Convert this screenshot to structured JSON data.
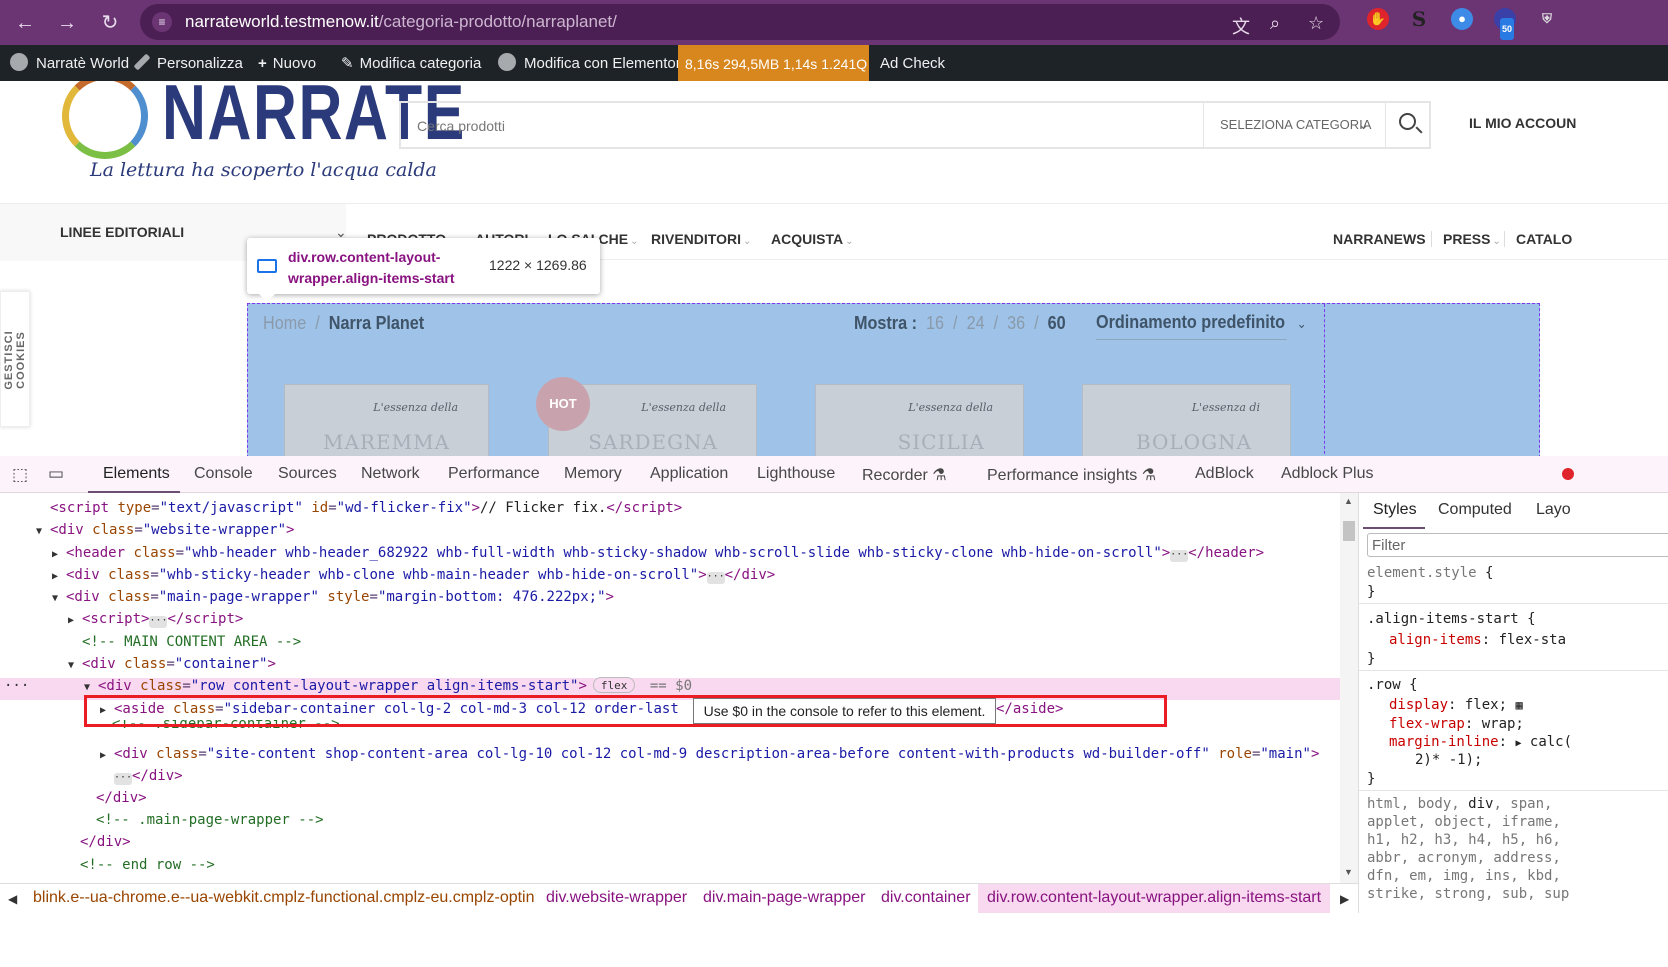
{
  "browser": {
    "url_host": "narrateworld.testmenow.it",
    "url_path": "/categoria-prodotto/narraplanet/",
    "nav": {
      "back": "←",
      "forward": "→",
      "reload": "↻"
    },
    "icons": [
      "translate-icon",
      "zoom-icon",
      "bookmark-star-icon"
    ],
    "extension_badge": "50"
  },
  "adminbar": {
    "site": "Narratè World",
    "customize": "Personalizza",
    "new": "Nuovo",
    "edit_category": "Modifica categoria",
    "elementor": "Modifica con Elementor",
    "perf": "8,16s  294,5MB  1,14s  1.241Q",
    "adcheck": "Ad Check"
  },
  "site": {
    "logo_text": "NARRATE",
    "tagline": "La lettura ha scoperto l'acqua calda",
    "search_placeholder": "Cerca prodotti",
    "category_select": "SELEZIONA CATEGORIA",
    "account": "IL MIO ACCOUN",
    "linee": "LINEE EDITORIALI",
    "menu": [
      "PRODOTTO",
      "AUTORI",
      "LO SAI CHE",
      "RIVENDITORI",
      "ACQUISTA"
    ],
    "menu_right": [
      "NARRANEWS",
      "PRESS",
      "CATALO"
    ],
    "cookies": "GESTISCI COOKIES",
    "breadcrumb_home": "Home",
    "breadcrumb_sep": "/",
    "breadcrumb_current": "Narra Planet",
    "mostra_label": "Mostra :",
    "mostra_options": [
      "16",
      "24",
      "36",
      "60"
    ],
    "mostra_selected": "60",
    "ordering": "Ordinamento predefinito",
    "hot_badge": "HOT",
    "books": [
      {
        "t1": "L'essenza della",
        "t2": "MAREMMA"
      },
      {
        "t1": "L'essenza della",
        "t2": "SARDEGNA"
      },
      {
        "t1": "L'essenza della",
        "t2": "SICILIA"
      },
      {
        "t1": "L'essenza di",
        "t2": "BOLOGNA"
      }
    ]
  },
  "inspect_tooltip": {
    "name": "div.row.content-layout-wrapper.align-items-start",
    "size": "1222 × 1269.86"
  },
  "devtools": {
    "tabs": [
      "Elements",
      "Console",
      "Sources",
      "Network",
      "Performance",
      "Memory",
      "Application",
      "Lighthouse",
      "Recorder",
      "Performance insights",
      "AdBlock",
      "Adblock Plus"
    ],
    "selected_tab": "Elements",
    "console_tip": "Use $0 in the console to refer to this element.",
    "flex_badge": "flex",
    "dollar_zero": "== $0",
    "styles_tabs": [
      "Styles",
      "Computed",
      "Layo"
    ],
    "filter_placeholder": "Filter",
    "crumbs": [
      "blink.e--ua-chrome.e--ua-webkit.cmplz-functional.cmplz-eu.cmplz-optin",
      "div.website-wrapper",
      "div.main-page-wrapper",
      "div.container",
      "div.row.content-layout-wrapper.align-items-start"
    ]
  }
}
